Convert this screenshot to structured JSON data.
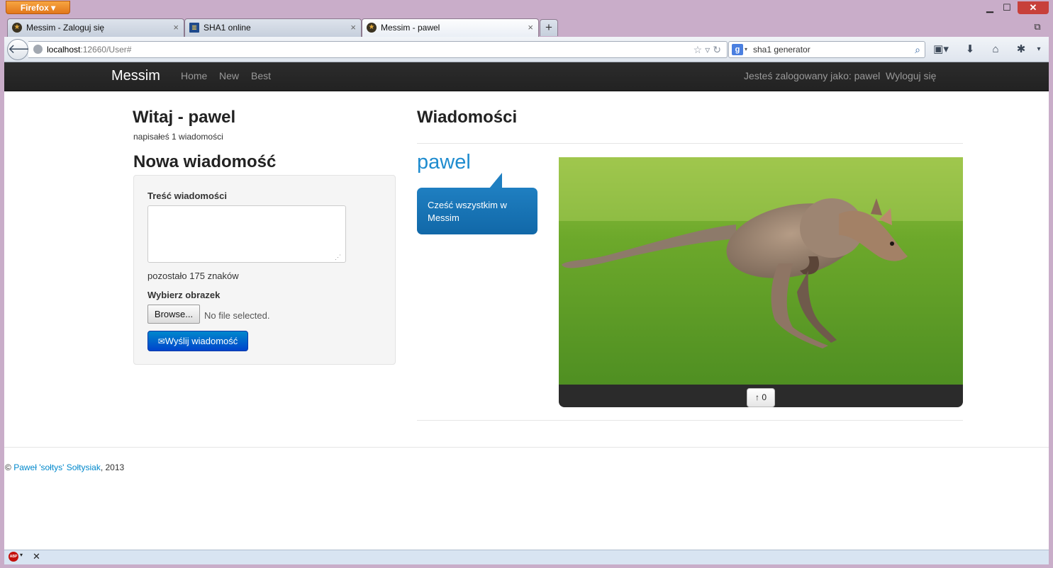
{
  "browser": {
    "app_button": "Firefox",
    "window_controls": {
      "minimize": "▁",
      "maximize": "☐",
      "close": "✕"
    },
    "tabs": [
      {
        "title": "Messim - Zaloguj się",
        "close": "×"
      },
      {
        "title": "SHA1 online",
        "close": "×"
      },
      {
        "title": "Messim - pawel",
        "close": "×"
      }
    ],
    "new_tab": "+",
    "url": {
      "host": "localhost",
      "path": ":12660/User#"
    },
    "search": {
      "value": "sha1 generator",
      "engine_letter": "g"
    }
  },
  "site": {
    "brand": "Messim",
    "nav": {
      "home": "Home",
      "new": "New",
      "best": "Best"
    },
    "logged_in_as": "Jesteś zalogowany jako: pawel",
    "logout": "Wyloguj się"
  },
  "sidebar": {
    "greeting": "Witaj - pawel",
    "message_count": "napisałeś 1 wiadomości",
    "new_message_heading": "Nowa wiadomość",
    "form": {
      "content_label": "Treść wiadomości",
      "content_value": "",
      "remaining": "pozostało 175 znaków",
      "image_label": "Wybierz obrazek",
      "browse_label": "Browse...",
      "file_status": "No file selected.",
      "send_label": "Wyślij wiadomość",
      "send_icon": "envelope-icon"
    }
  },
  "messages": {
    "heading": "Wiadomości",
    "items": [
      {
        "author": "pawel",
        "text": "Cześć wszystkim w Messim",
        "image": "kangaroo-photo",
        "votes_label": "↑ 0"
      }
    ]
  },
  "footer": {
    "copyright": "©",
    "author_link": "Paweł 'sołtys' Sołtysiak",
    "year": ", 2013"
  },
  "colors": {
    "navbar": "#222222",
    "link": "#0088cc",
    "bubble": "#1f7fc1",
    "send_button": "#0066cc"
  }
}
